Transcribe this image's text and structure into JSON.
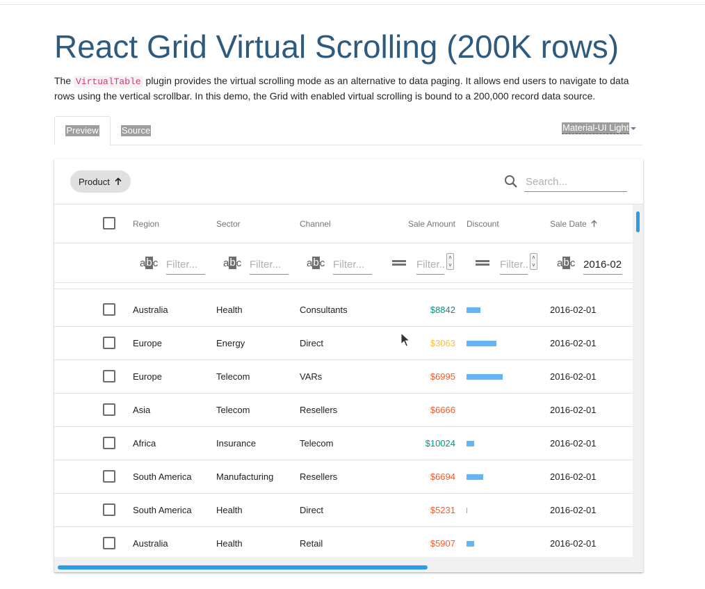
{
  "page": {
    "title": "React Grid Virtual Scrolling (200K rows)",
    "intro_before": "The ",
    "intro_code": "VirtualTable",
    "intro_after": " plugin provides the virtual scrolling mode as an alternative to data paging. It allows end users to navigate to data rows using the vertical scrollbar. In this demo, the Grid with enabled virtual scrolling is bound to a 200,000 record data source."
  },
  "tabs": [
    {
      "label": "Preview",
      "active": true
    },
    {
      "label": "Source",
      "active": false
    }
  ],
  "theme_selector": {
    "label": "Material-UI Light"
  },
  "toolbar": {
    "group_chip": "Product",
    "search_placeholder": "Search...",
    "search_icon": "search-icon"
  },
  "columns": [
    {
      "key": "region",
      "label": "Region"
    },
    {
      "key": "sector",
      "label": "Sector"
    },
    {
      "key": "channel",
      "label": "Channel"
    },
    {
      "key": "amount",
      "label": "Sale Amount"
    },
    {
      "key": "discount",
      "label": "Discount"
    },
    {
      "key": "date",
      "label": "Sale Date"
    }
  ],
  "filters": {
    "placeholder": "Filter...",
    "text_type_glyph": [
      "a",
      "b",
      "c"
    ],
    "date_value": "2016-02"
  },
  "colors": {
    "amount_high": "#009688",
    "amount_mid": "#fbc02d",
    "amount_low": "#ff5722",
    "discount_bar": "#64b5f6",
    "scroll_thumb": "#2e9be6"
  },
  "rows": [
    {
      "region": "Australia",
      "sector": "Health",
      "channel": "Consultants",
      "amount": "$8842",
      "amount_level": "high",
      "discount": 0.14,
      "date": "2016-02-01"
    },
    {
      "region": "Europe",
      "sector": "Energy",
      "channel": "Direct",
      "amount": "$3063",
      "amount_level": "mid",
      "discount": 0.31,
      "date": "2016-02-01"
    },
    {
      "region": "Europe",
      "sector": "Telecom",
      "channel": "VARs",
      "amount": "$6995",
      "amount_level": "low",
      "discount": 0.37,
      "date": "2016-02-01"
    },
    {
      "region": "Asia",
      "sector": "Telecom",
      "channel": "Resellers",
      "amount": "$6666",
      "amount_level": "low",
      "discount": 0,
      "date": "2016-02-01"
    },
    {
      "region": "Africa",
      "sector": "Insurance",
      "channel": "Telecom",
      "amount": "$10024",
      "amount_level": "high",
      "discount": 0.08,
      "date": "2016-02-01"
    },
    {
      "region": "South America",
      "sector": "Manufacturing",
      "channel": "Resellers",
      "amount": "$6694",
      "amount_level": "low",
      "discount": 0.17,
      "date": "2016-02-01"
    },
    {
      "region": "South America",
      "sector": "Health",
      "channel": "Direct",
      "amount": "$5231",
      "amount_level": "low",
      "discount": 0.01,
      "date": "2016-02-01"
    },
    {
      "region": "Australia",
      "sector": "Health",
      "channel": "Retail",
      "amount": "$5907",
      "amount_level": "low",
      "discount": 0.08,
      "date": "2016-02-01"
    }
  ]
}
